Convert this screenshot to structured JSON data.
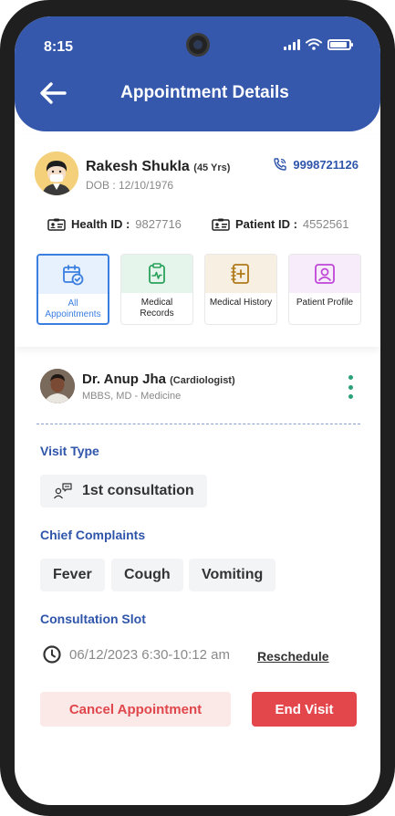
{
  "status_bar": {
    "time": "8:15"
  },
  "header": {
    "title": "Appointment Details"
  },
  "patient": {
    "name": "Rakesh Shukla",
    "age": "(45 Yrs)",
    "dob": "DOB : 12/10/1976",
    "phone": "9998721126",
    "health_id_label": "Health ID :",
    "health_id": "9827716",
    "patient_id_label": "Patient ID :",
    "patient_id": "4552561"
  },
  "tiles": [
    {
      "label": "All Appointments",
      "icon": "calendar-check-icon",
      "bg": "#e7f1fd",
      "color": "#3a7fe0",
      "active": true
    },
    {
      "label": "Medical Records",
      "icon": "clipboard-pulse-icon",
      "bg": "#e6f5ec",
      "color": "#2aa15a",
      "active": false
    },
    {
      "label": "Medical History",
      "icon": "medical-book-icon",
      "bg": "#f7f0e2",
      "color": "#b07a1a",
      "active": false
    },
    {
      "label": "Patient Profile",
      "icon": "profile-card-icon",
      "bg": "#f6ecfa",
      "color": "#c046d8",
      "active": false
    }
  ],
  "doctor": {
    "name": "Dr. Anup Jha",
    "specialty": "(Cardiologist)",
    "qualification": "MBBS, MD - Medicine"
  },
  "visit": {
    "type_label": "Visit Type",
    "type": "1st consultation",
    "complaints_label": "Chief Complaints",
    "complaints": [
      "Fever",
      "Cough",
      "Vomiting"
    ],
    "slot_label": "Consultation Slot",
    "slot": "06/12/2023 6:30-10:12 am",
    "reschedule": "Reschedule"
  },
  "actions": {
    "cancel": "Cancel Appointment",
    "end": "End Visit"
  },
  "colors": {
    "primary": "#3558ad",
    "accent_blue": "#2f55aa",
    "danger": "#e3474b",
    "teal": "#2aa17a"
  }
}
